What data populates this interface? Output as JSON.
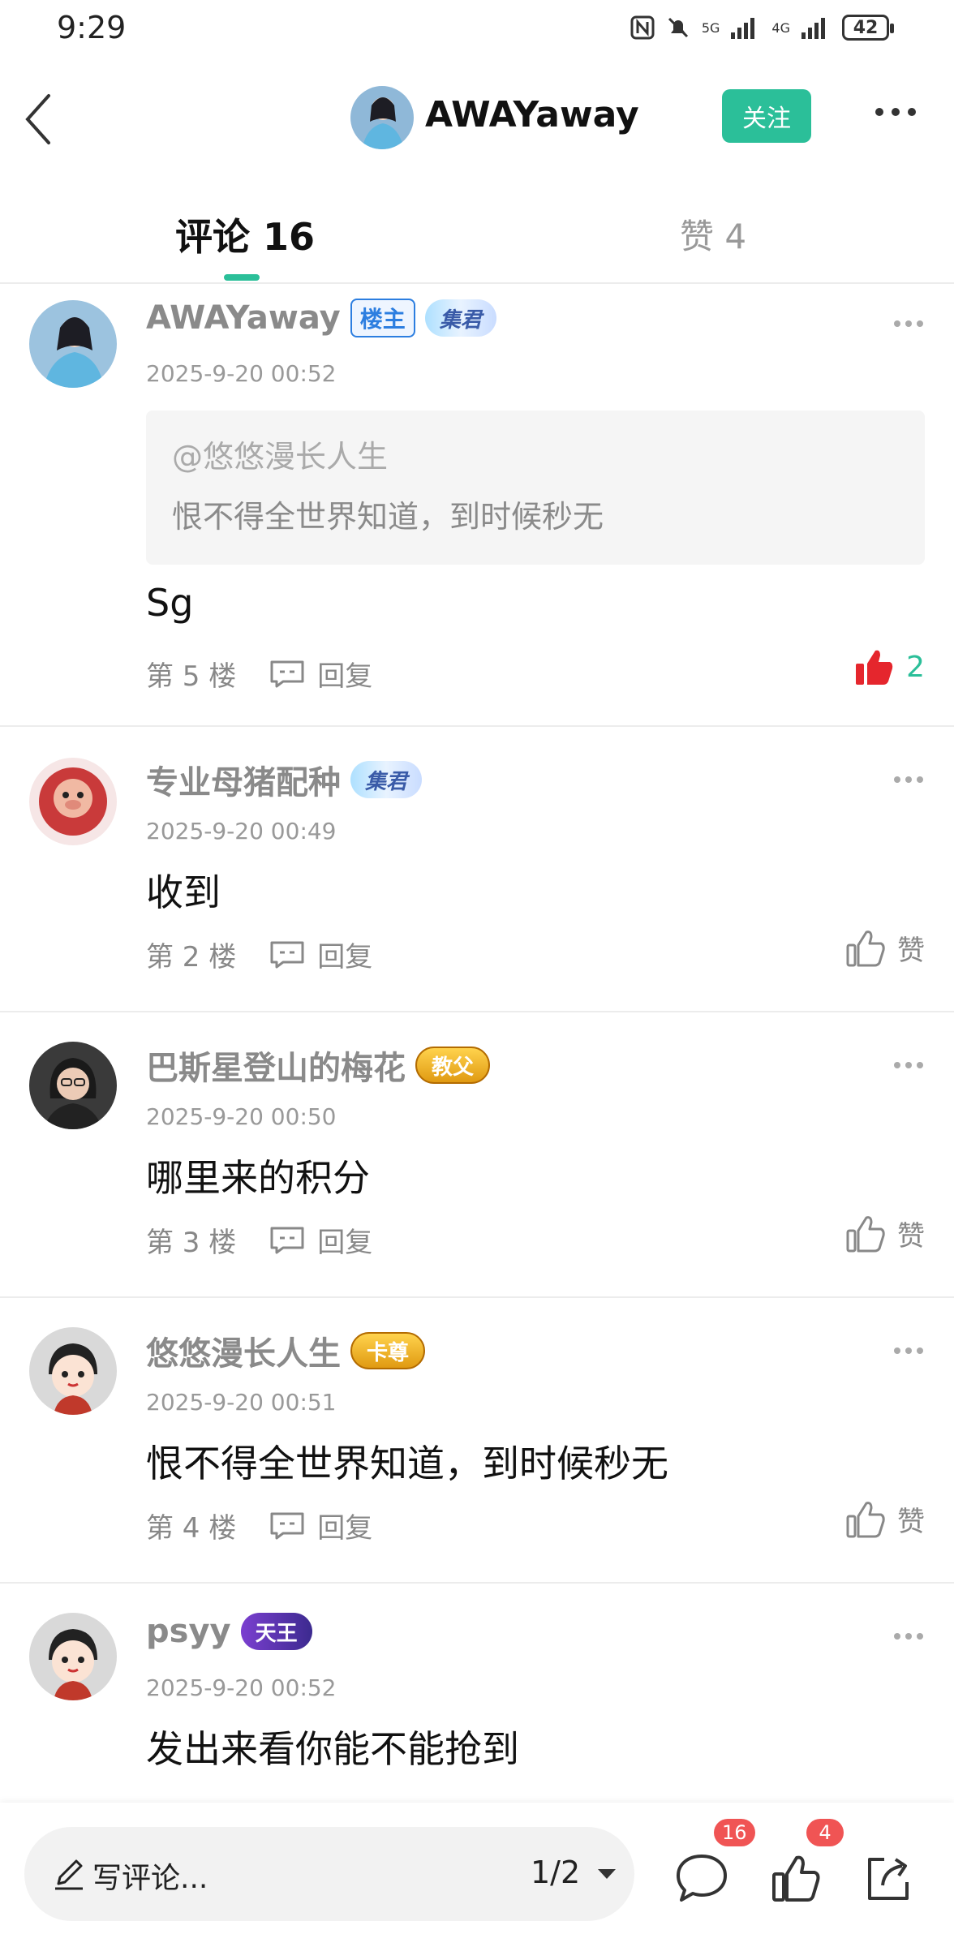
{
  "status_bar": {
    "time": "9:29",
    "signal_labels": [
      "5G",
      "4G"
    ],
    "battery": "42"
  },
  "header": {
    "username": "AWAYaway",
    "follow_label": "关注"
  },
  "tabs": {
    "comments": "评论 16",
    "likes": "赞 4"
  },
  "comments": [
    {
      "name": "AWAYaway",
      "owner_badge": "楼主",
      "medal": "集君",
      "time": "2025-9-20 00:52",
      "quote_user": "@悠悠漫长人生",
      "quote_text": "恨不得全世界知道，到时候秒无",
      "content": "Sg",
      "floor": "第 5 楼",
      "reply_label": "回复",
      "like_count": "2"
    },
    {
      "name": "专业母猪配种",
      "medal": "集君",
      "time": "2025-9-20 00:49",
      "content": "收到",
      "floor": "第 2 楼",
      "reply_label": "回复",
      "like_label": "赞"
    },
    {
      "name": "巴斯星登山的梅花",
      "medal": "教父",
      "time": "2025-9-20 00:50",
      "content": "哪里来的积分",
      "floor": "第 3 楼",
      "reply_label": "回复",
      "like_label": "赞"
    },
    {
      "name": "悠悠漫长人生",
      "medal": "卡尊",
      "time": "2025-9-20 00:51",
      "content": "恨不得全世界知道，到时候秒无",
      "floor": "第 4 楼",
      "reply_label": "回复",
      "like_label": "赞"
    },
    {
      "name": "psyy",
      "medal": "天王",
      "time": "2025-9-20 00:52",
      "content": "发出来看你能不能抢到"
    }
  ],
  "bottom_bar": {
    "placeholder": "写评论...",
    "page": "1/2",
    "comment_badge": "16",
    "like_badge": "4"
  },
  "colors": {
    "accent": "#2bbf99",
    "liked_red": "#e5262d",
    "badge_red": "#f05454"
  }
}
